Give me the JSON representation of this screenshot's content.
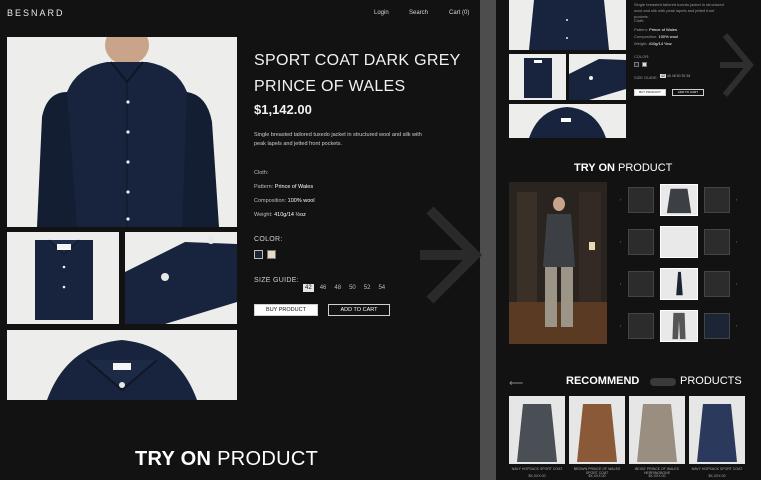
{
  "brand": "BESNARD",
  "nav": {
    "login": "Login",
    "search": "Search",
    "cart": "Cart (0)"
  },
  "product": {
    "title": "SPORT COAT DARK GREY PRINCE OF WALES",
    "price": "$1,142.00",
    "description": "Single breasted tailored tuxedo jacket in structured wool and silk with peak lapels and jetted front pockets.",
    "cloth_label": "Cloth:",
    "pattern_label": "Pattern:",
    "pattern": "Prince of Wales",
    "composition_label": "Composition:",
    "composition": "100% wool",
    "weight_label": "Weight:",
    "weight": "410g/14 ½oz",
    "color_label": "COLOR:",
    "colors": [
      "#1c2536",
      "#e8dcc6"
    ],
    "size_label": "SIZE GUIDE:",
    "sizes": [
      "42",
      "46",
      "48",
      "50",
      "52",
      "54"
    ],
    "selected_size": "42",
    "buy": "BUY PRODUCT",
    "add": "ADD TO CART"
  },
  "try_on": {
    "bold": "TRY ON",
    "light": "PRODUCT"
  },
  "recommend": {
    "bold": "RECOMMEND",
    "light": "PRODUCTS",
    "items": [
      {
        "name": "NAVY HOPSACK SPORT COAT",
        "price": "$X,XXX.00",
        "color": "#4a4f55"
      },
      {
        "name": "BROWN PRINCE OF WALES SPORT COAT",
        "price": "$X,XXX.00",
        "color": "#8a5a38"
      },
      {
        "name": "BEIGE PRINCE OF WALES HERRINGBONE",
        "price": "$X,XXX.00",
        "color": "#9a8e80"
      },
      {
        "name": "NAVY HOPSACK SPORT COAT",
        "price": "$X,XXX.00",
        "color": "#2b3a5c"
      }
    ]
  },
  "colors": {
    "bg": "#121212",
    "shirt": "#18243d",
    "accent": "#ffffff"
  }
}
